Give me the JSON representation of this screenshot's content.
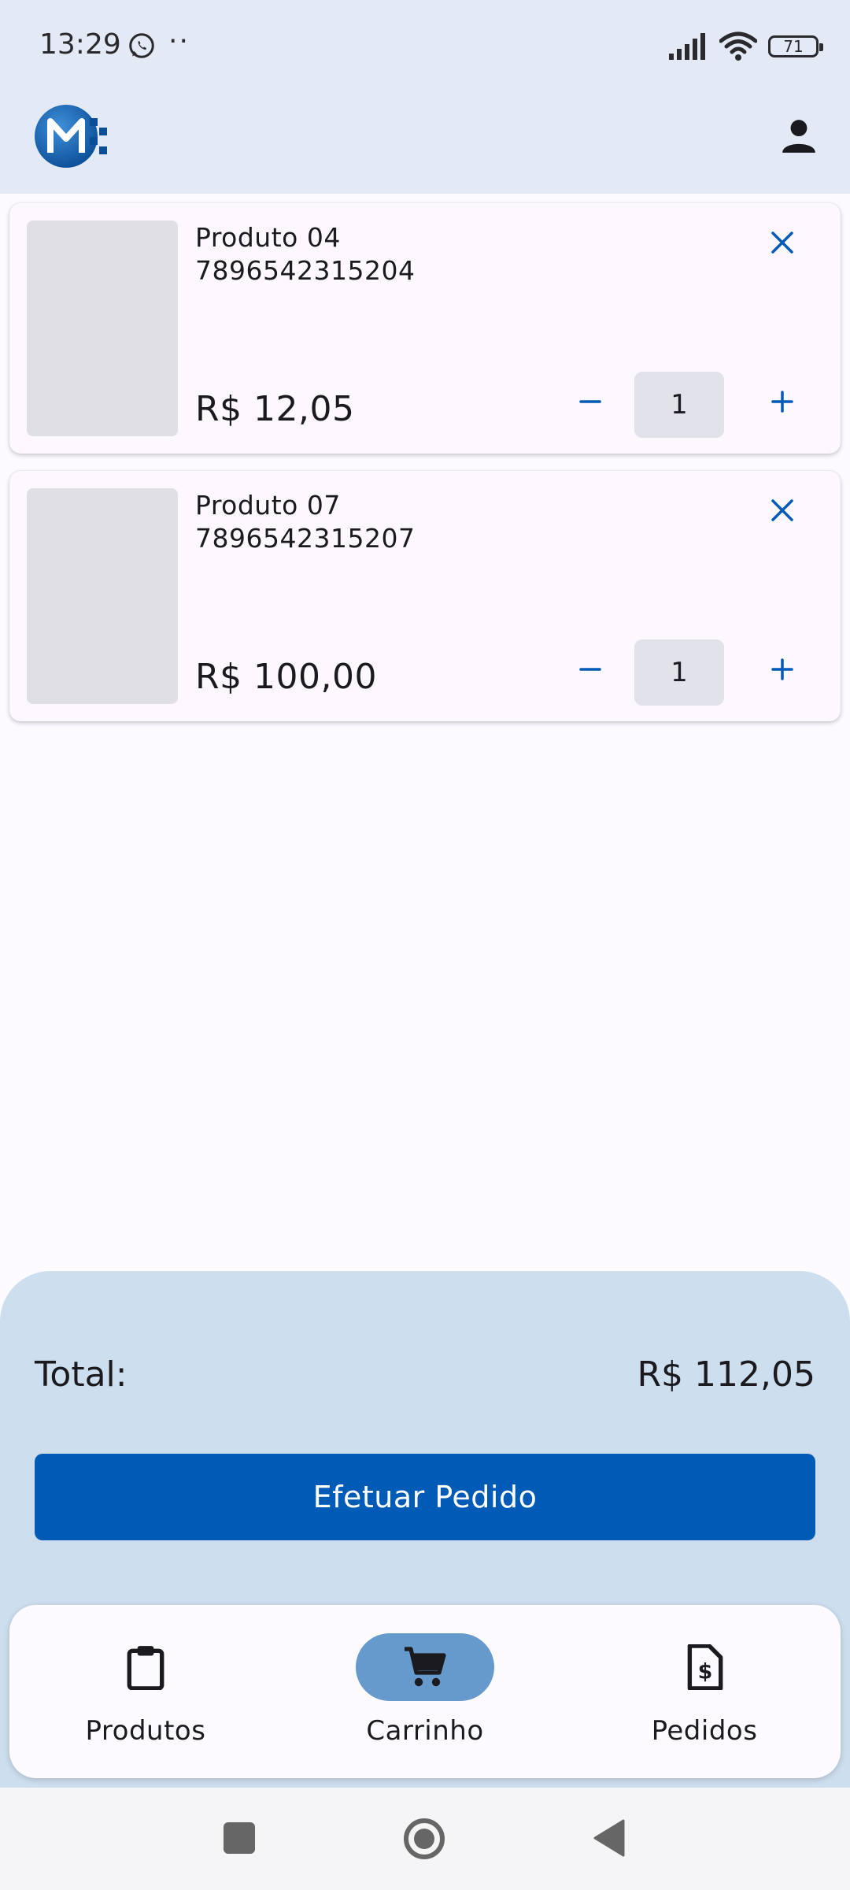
{
  "status_bar": {
    "time": "13:29",
    "dots": "··",
    "battery": "71",
    "icons": [
      "whatsapp-icon",
      "signal-icon",
      "wifi-icon",
      "battery-icon"
    ]
  },
  "app_bar": {
    "logo_icon": "m-logo-icon",
    "account_icon": "person-icon"
  },
  "cart": {
    "items": [
      {
        "name": "Produto 04",
        "code": "7896542315204",
        "price": "R$ 12,05",
        "quantity": "1"
      },
      {
        "name": "Produto 07",
        "code": "7896542315207",
        "price": "R$ 100,00",
        "quantity": "1"
      }
    ]
  },
  "summary": {
    "total_label": "Total:",
    "total_value": "R$ 112,05",
    "order_button": "Efetuar Pedido"
  },
  "bottom_nav": {
    "items": [
      {
        "label": "Produtos",
        "icon": "clipboard-icon",
        "active": false
      },
      {
        "label": "Carrinho",
        "icon": "cart-icon",
        "active": true
      },
      {
        "label": "Pedidos",
        "icon": "invoice-icon",
        "active": false
      }
    ]
  },
  "colors": {
    "primary": "#005bb6",
    "header_bg": "#e3e9f5",
    "summary_bg": "#cddeef",
    "active_pill": "#6699cc"
  }
}
